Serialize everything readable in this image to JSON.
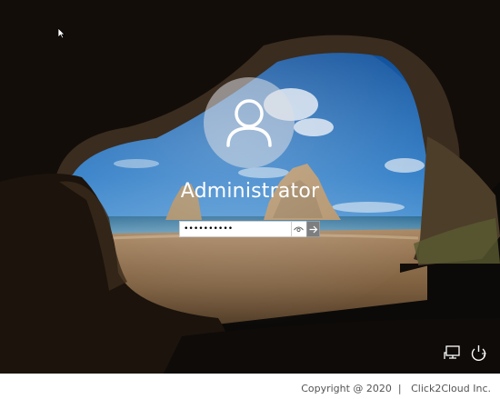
{
  "login": {
    "username": "Administrator",
    "password_value": "••••••••••",
    "icons": {
      "avatar": "user-avatar-icon",
      "reveal": "eye-icon",
      "submit": "arrow-right-icon",
      "network": "network-icon",
      "power": "power-icon"
    }
  },
  "footer": {
    "copyright": "Copyright @ 2020  |   Click2Cloud Inc."
  },
  "colors": {
    "submit_button": "#7c7e80",
    "text": "#ffffff",
    "footer_text": "#555555"
  }
}
